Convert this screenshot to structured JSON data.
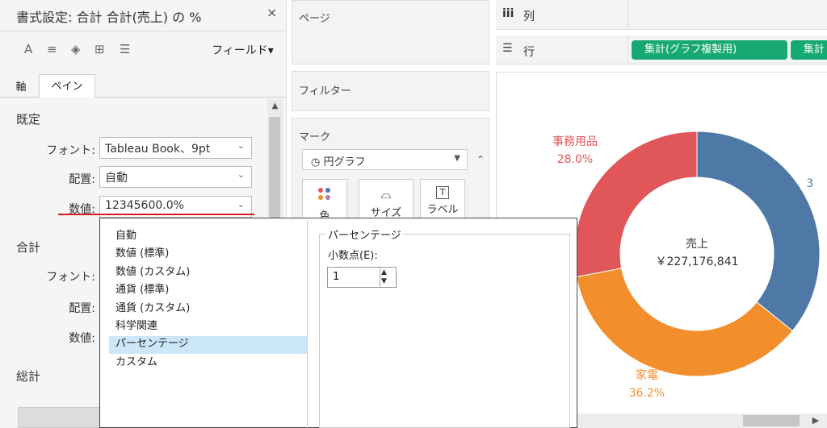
{
  "format_pane": {
    "title": "書式設定: 合計 合計(売上) の %",
    "close": "×",
    "toolbar": {
      "a_icon": "A",
      "align_icon": "≡",
      "shade_icon": "◈",
      "border_icon": "⊞",
      "lines_icon": "☰",
      "fields_label": "フィールド▾"
    },
    "tabs": {
      "axis": "軸",
      "pane": "ペイン"
    },
    "default_section": "既定",
    "total_section": "合計",
    "grand_total_section": "総計",
    "font_label": "フォント:",
    "align_label": "配置:",
    "number_label": "数値:",
    "font_value": "Tableau Book、9pt",
    "align_value": "自動",
    "number_value": "12345600.0%",
    "chevron": "⌄",
    "scroll_up": "▲"
  },
  "shelves": {
    "pages": "ページ",
    "filters": "フィルター",
    "marks": "マーク",
    "mark_type": "◷ 円グラフ",
    "mark_type_arrow": "▼",
    "marks_scroll": "⌃",
    "color_label": "色",
    "size_label": "サイズ",
    "label_label": "ラベル",
    "size_icon": "⌓",
    "label_icon": "T",
    "columns": "列",
    "columns_icon": "iii",
    "rows": "行",
    "rows_icon": "☰",
    "pills": [
      "集計(グラフ複製用)",
      "集計"
    ]
  },
  "chart_data": {
    "type": "pie",
    "donut": true,
    "center_title": "売上",
    "center_value": "￥227,176,841",
    "slices": [
      {
        "name": "",
        "label": "3",
        "percent": 35.8,
        "color": "#4e79a7"
      },
      {
        "name": "家電",
        "label": "36.2%",
        "percent": 36.2,
        "color": "#f28e2b"
      },
      {
        "name": "事務用品",
        "label": "28.0%",
        "percent": 28.0,
        "color": "#e15759"
      }
    ]
  },
  "popup": {
    "options": [
      "自動",
      "数値 (標準)",
      "数値 (カスタム)",
      "通貨 (標準)",
      "通貨 (カスタム)",
      "科学関連",
      "パーセンテージ",
      "カスタム"
    ],
    "selected_index": 6,
    "group_title": "パーセンテージ",
    "decimal_label": "小数点(E):",
    "decimal_value": "1",
    "spin_up": "▲",
    "spin_down": "▼"
  },
  "view_scroll_right": "▶"
}
